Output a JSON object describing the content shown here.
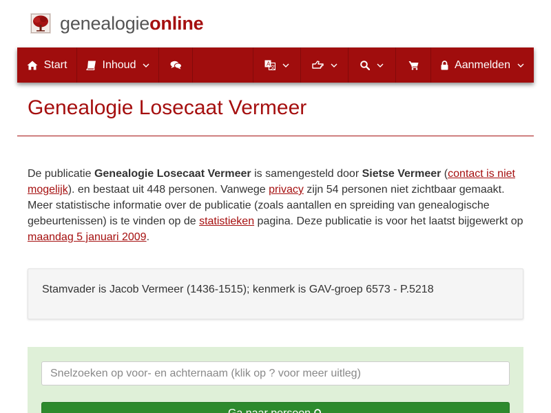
{
  "brand": {
    "part1": "genealogie",
    "part2": "online"
  },
  "nav": {
    "start_label": "Start",
    "inhoud_label": "Inhoud",
    "login_label": "Aanmelden"
  },
  "page": {
    "title": "Genealogie Losecaat Vermeer"
  },
  "intro": {
    "t1": "De publicatie ",
    "pub_name": "Genealogie Losecaat Vermeer",
    "t2": " is samengesteld door ",
    "author": "Sietse Vermeer",
    "t3": " (",
    "contact_link": "contact is niet mogelijk",
    "t4": "). en bestaat uit 448 personen. Vanwege ",
    "privacy_link": "privacy",
    "t5": " zijn 54 personen niet zichtbaar gemaakt. Meer statistische informatie over de publicatie (zoals aantallen en spreiding van genealogische gebeurtenissen) is te vinden op de ",
    "stats_link": "statistieken",
    "t6": " pagina. Deze publicatie is voor het laatst bijgewerkt op ",
    "date_link": "maandag 5 januari 2009",
    "t7": "."
  },
  "note": {
    "text": "Stamvader is Jacob Vermeer (1436-1515); kenmerk is GAV-groep 6573 - P.5218"
  },
  "search": {
    "placeholder": "Snelzoeken op voor- en achternaam (klik op ? voor meer uitleg)",
    "button_label": "Ga naar persoon"
  },
  "colors": {
    "brand_red": "#a50f0f",
    "navbar": "#a00d0d",
    "panel_green": "#dff0d8",
    "button_green": "#2d8a2d"
  },
  "icons": [
    "tree-logo-icon",
    "home-icon",
    "book-icon",
    "comments-icon",
    "language-icon",
    "pointer-hand-icon",
    "search-icon",
    "cart-icon",
    "lock-icon",
    "chevron-down-icon"
  ]
}
